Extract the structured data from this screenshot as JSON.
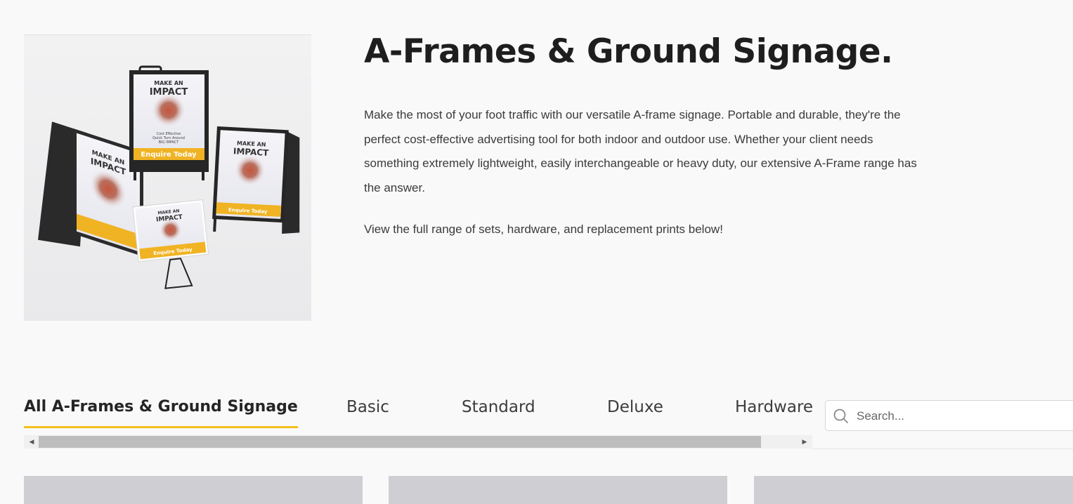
{
  "hero": {
    "title": "A-Frames & Ground Signage.",
    "image": {
      "sign_big_line1": "MAKE AN",
      "sign_big_line2": "IMPACT",
      "sign_cta": "Enquire Today",
      "sign_small_text": "Cost Effective",
      "sign_small_text2": "Quick Turn Around",
      "sign_small_text3": "BIG IMPACT"
    },
    "paragraph1": "Make the most of your foot traffic with our versatile A-frame signage. Portable and durable, they're the perfect cost-effective advertising tool for both indoor and outdoor use. Whether your client needs something extremely lightweight, easily interchangeable or heavy duty, our extensive A-Frame range has the answer.",
    "paragraph2": "View the full range of sets, hardware, and replacement prints below!"
  },
  "tabs": [
    {
      "label": "All A-Frames & Ground Signage",
      "active": true
    },
    {
      "label": "Basic",
      "active": false
    },
    {
      "label": "Standard",
      "active": false
    },
    {
      "label": "Deluxe",
      "active": false
    },
    {
      "label": "Hardware",
      "active": false
    }
  ],
  "search": {
    "placeholder": "Search..."
  },
  "colors": {
    "accent": "#f2c11d",
    "title": "#1e1e1e",
    "card_placeholder": "#cfcfd3"
  },
  "icons": {
    "search": "search-icon",
    "scroll_left": "triangle-left-icon",
    "scroll_right": "triangle-right-icon"
  }
}
